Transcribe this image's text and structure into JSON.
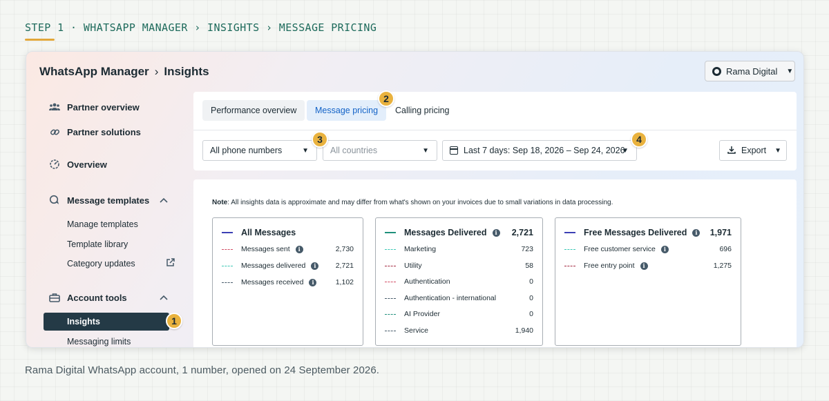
{
  "step_label": "STEP 1 · WHATSAPP MANAGER › INSIGHTS › MESSAGE PRICING",
  "header": {
    "app_name": "WhatsApp Manager",
    "separator": "›",
    "page": "Insights",
    "account_name": "Rama Digital"
  },
  "sidebar": {
    "items": [
      {
        "label": "Partner overview",
        "icon": "people-icon"
      },
      {
        "label": "Partner solutions",
        "icon": "link-icon"
      },
      {
        "label": "Overview",
        "icon": "gauge-icon"
      },
      {
        "label": "Message templates",
        "icon": "chat-icon"
      },
      {
        "label": "Account tools",
        "icon": "toolbox-icon"
      }
    ],
    "templates_sub": [
      "Manage templates",
      "Template library",
      "Category updates"
    ],
    "tools_sub": [
      "Insights",
      "Messaging limits"
    ]
  },
  "tabs": [
    "Performance overview",
    "Message pricing",
    "Calling pricing"
  ],
  "filters": {
    "phone": "All phone numbers",
    "countries_placeholder": "All countries",
    "date_range": "Last 7 days: Sep 18, 2026 – Sep 24, 2026",
    "export": "Export"
  },
  "badges": [
    "1",
    "2",
    "3",
    "4"
  ],
  "note_prefix": "Note",
  "note_text": ": All insights data is approximate and may differ from what's shown on your invoices due to small variations in data processing.",
  "cards": [
    {
      "title": "All Messages",
      "total": "",
      "color": "#3b3fb5",
      "rows": [
        {
          "label": "Messages sent",
          "value": "2,730",
          "color": "#d14b63"
        },
        {
          "label": "Messages delivered",
          "value": "2,721",
          "color": "#3cc8b4"
        },
        {
          "label": "Messages received",
          "value": "1,102",
          "color": "#465a69"
        }
      ]
    },
    {
      "title": "Messages Delivered",
      "total": "2,721",
      "color": "#1e8f7a",
      "rows": [
        {
          "label": "Marketing",
          "value": "723",
          "color": "#3cc8b4"
        },
        {
          "label": "Utility",
          "value": "58",
          "color": "#a3273f"
        },
        {
          "label": "Authentication",
          "value": "0",
          "color": "#d14b63"
        },
        {
          "label": "Authentication - international",
          "value": "0",
          "color": "#465a69"
        },
        {
          "label": "AI Provider",
          "value": "0",
          "color": "#1e8f7a"
        },
        {
          "label": "Service",
          "value": "1,940",
          "color": "#465a69"
        }
      ]
    },
    {
      "title": "Free Messages Delivered",
      "total": "1,971",
      "color": "#3b3fb5",
      "rows": [
        {
          "label": "Free customer service",
          "value": "696",
          "color": "#3cc8b4"
        },
        {
          "label": "Free entry point",
          "value": "1,275",
          "color": "#a3273f"
        }
      ]
    }
  ],
  "caption": "Rama Digital WhatsApp account, 1 number, opened on 24 September 2026."
}
